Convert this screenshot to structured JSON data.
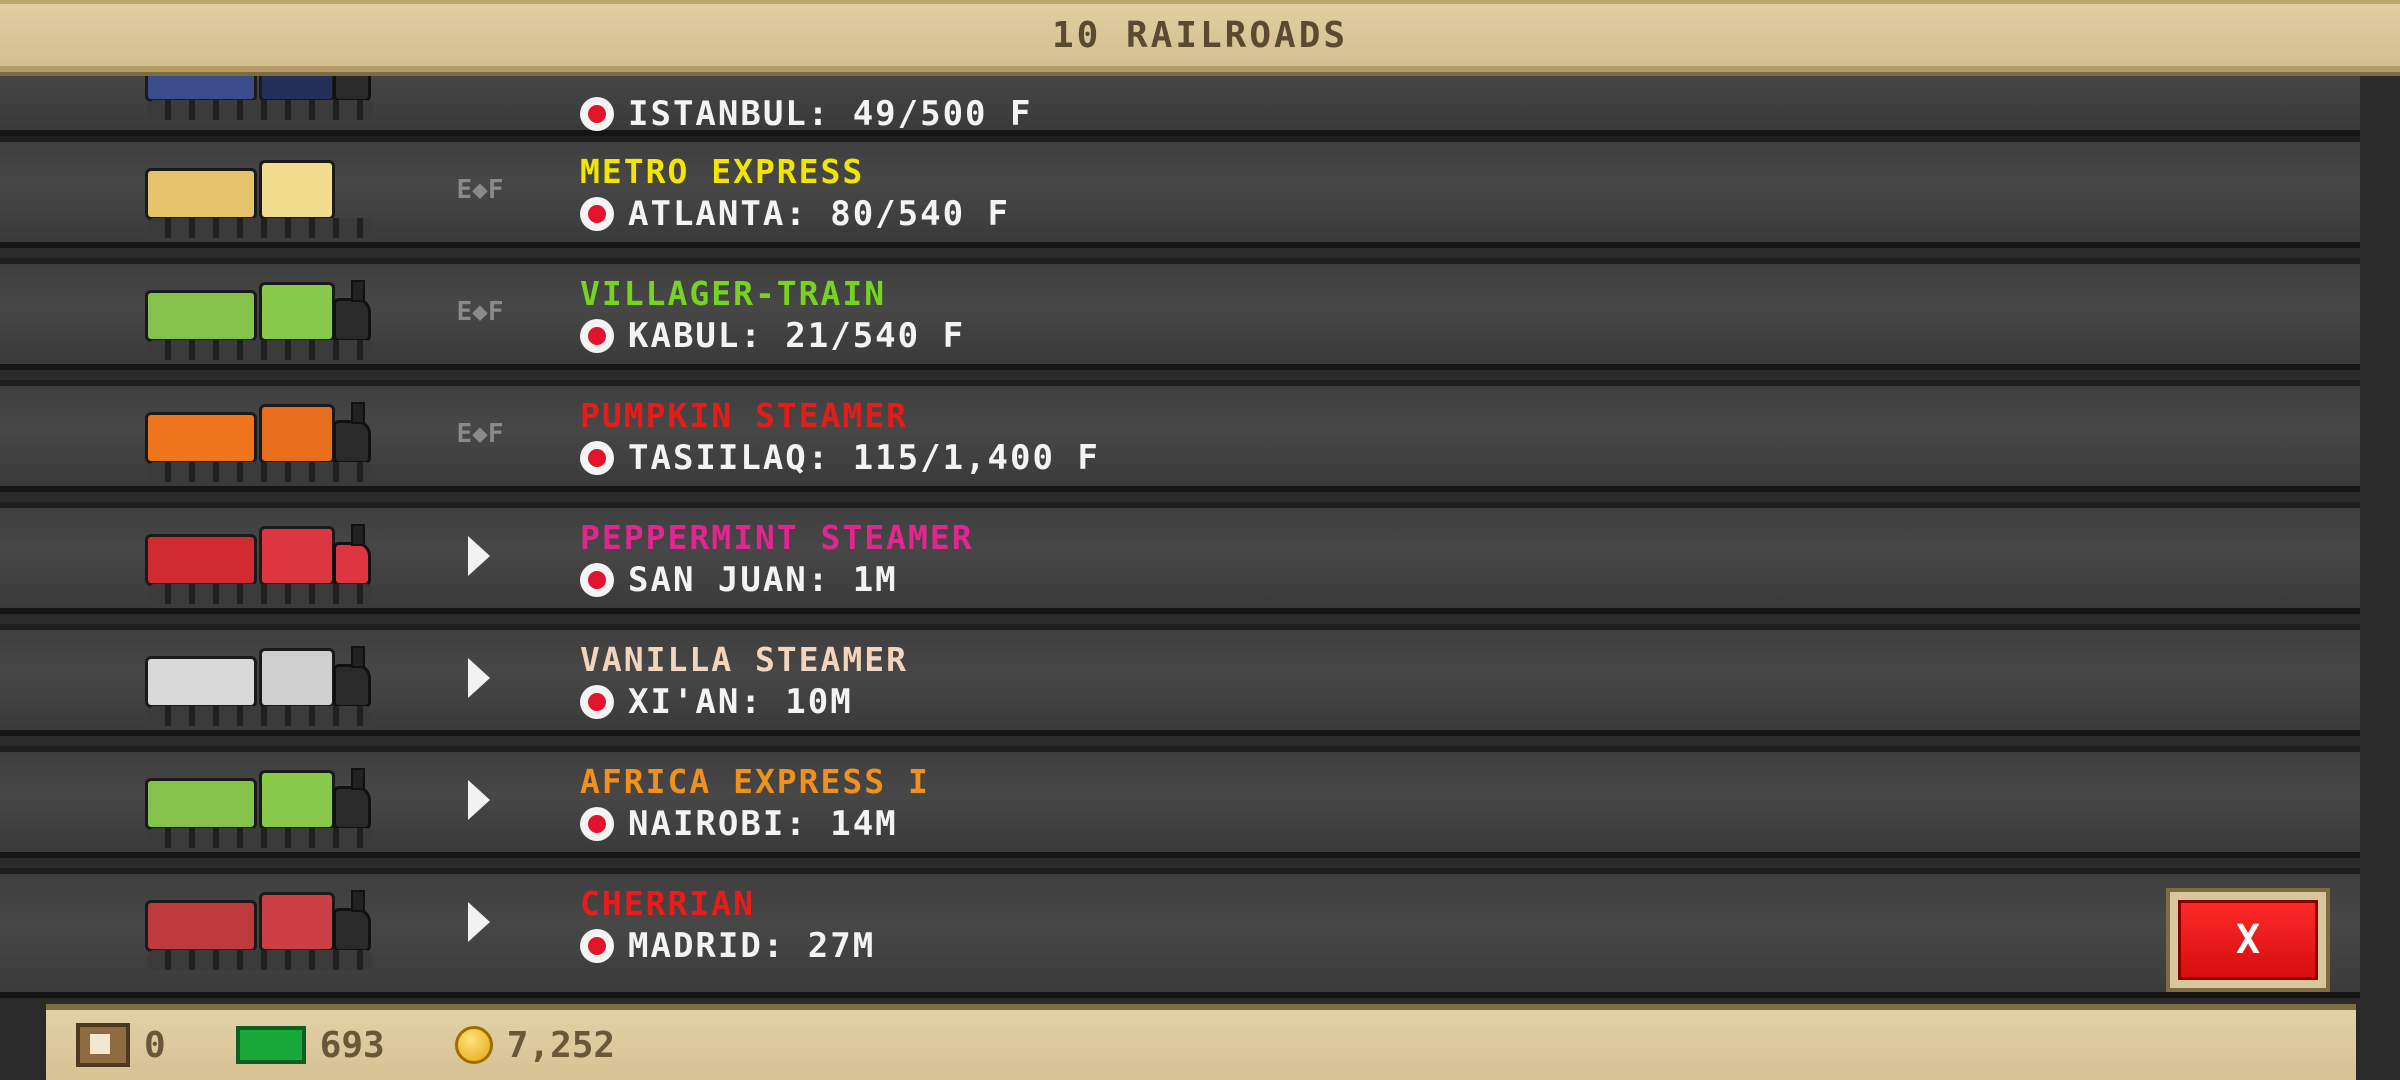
{
  "header": {
    "title": "10 RAILROADS"
  },
  "rows": [
    {
      "name": "",
      "name_color": "#ffffff",
      "destination": "ISTANBUL: 49/500 F",
      "status": "bell",
      "car": "#3b4c8a",
      "loco": "#25305a"
    },
    {
      "name": "METRO EXPRESS",
      "name_color": "#f2e600",
      "destination": "ATLANTA: 80/540 F",
      "status": "E◆F",
      "car": "#e4c36b",
      "loco": "#f2dc8e"
    },
    {
      "name": "VILLAGER-TRAIN",
      "name_color": "#77d321",
      "destination": "KABUL: 21/540 F",
      "status": "E◆F",
      "car": "#84c24b",
      "loco": "#88c94a"
    },
    {
      "name": "PUMPKIN STEAMER",
      "name_color": "#e51d18",
      "destination": "TASIILAQ: 115/1,400 F",
      "status": "E◆F",
      "car": "#f0741c",
      "loco": "#e86d1c"
    },
    {
      "name": "PEPPERMINT STEAMER",
      "name_color": "#e2268f",
      "destination": "SAN JUAN: 1M",
      "status": "play",
      "car": "#d12b32",
      "loco": "#de3640"
    },
    {
      "name": "VANILLA STEAMER",
      "name_color": "#f3d5bc",
      "destination": "XI'AN: 10M",
      "status": "play",
      "car": "#d9d9d9",
      "loco": "#cfcfcf"
    },
    {
      "name": "AFRICA EXPRESS I",
      "name_color": "#f0901e",
      "destination": "NAIROBI: 14M",
      "status": "play",
      "car": "#84c24b",
      "loco": "#88c94a"
    },
    {
      "name": "CHERRIAN",
      "name_color": "#ea1b1b",
      "destination": "MADRID: 27M",
      "status": "play",
      "car": "#bf3a3d",
      "loco": "#cc4045"
    }
  ],
  "close_button": {
    "label": "X"
  },
  "footer": {
    "crates": "0",
    "cash": "693",
    "coins": "7,252"
  }
}
